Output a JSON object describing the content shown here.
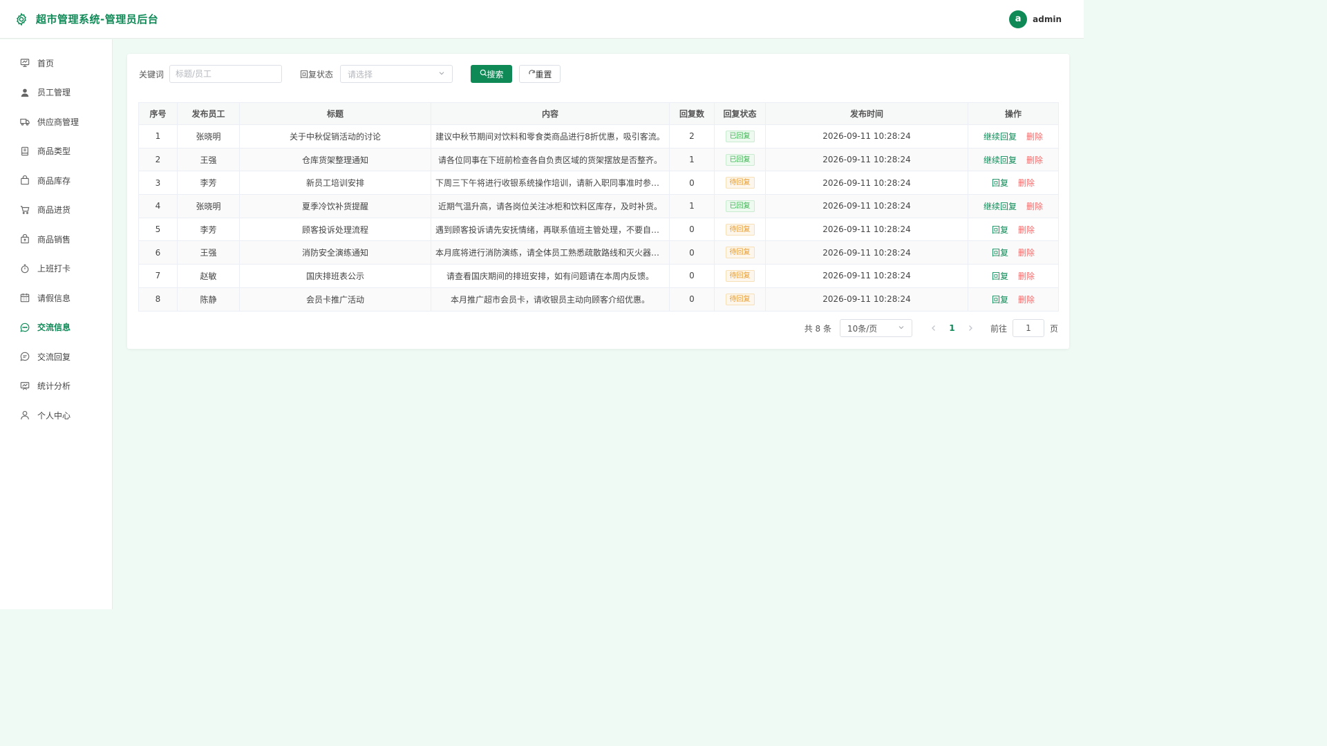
{
  "header": {
    "title": "超市管理系统-管理员后台",
    "avatar_letter": "a",
    "username": "admin",
    "logo_icon": "gear-icon"
  },
  "colors": {
    "primary": "#0f8a57",
    "danger": "#f56c6c",
    "tag_done": "#3bb34f",
    "tag_wait": "#e89b2a",
    "background": "#f0faf4"
  },
  "sidebar": {
    "items": [
      {
        "label": "首页",
        "icon": "home-icon"
      },
      {
        "label": "员工管理",
        "icon": "user-icon"
      },
      {
        "label": "供应商管理",
        "icon": "truck-icon"
      },
      {
        "label": "商品类型",
        "icon": "notebook-icon"
      },
      {
        "label": "商品库存",
        "icon": "bag-icon"
      },
      {
        "label": "商品进货",
        "icon": "cart-icon"
      },
      {
        "label": "商品销售",
        "icon": "sell-icon"
      },
      {
        "label": "上班打卡",
        "icon": "stopwatch-icon"
      },
      {
        "label": "请假信息",
        "icon": "calendar-icon"
      },
      {
        "label": "交流信息",
        "icon": "chat-dot-icon",
        "active": true
      },
      {
        "label": "交流回复",
        "icon": "chat-line-icon"
      },
      {
        "label": "统计分析",
        "icon": "data-board-icon"
      },
      {
        "label": "个人中心",
        "icon": "person-icon"
      }
    ]
  },
  "filters": {
    "keyword_label": "关键词",
    "keyword_placeholder": "标题/员工",
    "keyword_value": "",
    "status_label": "回复状态",
    "status_placeholder": "请选择",
    "search_label": "搜索",
    "reset_label": "重置"
  },
  "table": {
    "columns": [
      "序号",
      "发布员工",
      "标题",
      "内容",
      "回复数",
      "回复状态",
      "发布时间",
      "操作"
    ],
    "rows": [
      {
        "no": "1",
        "employee": "张晓明",
        "title": "关于中秋促销活动的讨论",
        "content": "建议中秋节期间对饮料和零食类商品进行8折优惠，吸引客流。",
        "replies": "2",
        "status": "已回复",
        "status_type": "done",
        "time": "2026-09-11 10:28:24",
        "reply_action": "继续回复",
        "delete_action": "删除"
      },
      {
        "no": "2",
        "employee": "王强",
        "title": "仓库货架整理通知",
        "content": "请各位同事在下班前检查各自负责区域的货架摆放是否整齐。",
        "replies": "1",
        "status": "已回复",
        "status_type": "done",
        "time": "2026-09-11 10:28:24",
        "reply_action": "继续回复",
        "delete_action": "删除"
      },
      {
        "no": "3",
        "employee": "李芳",
        "title": "新员工培训安排",
        "content": "下周三下午将进行收银系统操作培训，请新入职同事准时参加。",
        "replies": "0",
        "status": "待回复",
        "status_type": "wait",
        "time": "2026-09-11 10:28:24",
        "reply_action": "回复",
        "delete_action": "删除"
      },
      {
        "no": "4",
        "employee": "张晓明",
        "title": "夏季冷饮补货提醒",
        "content": "近期气温升高，请各岗位关注冰柜和饮料区库存，及时补货。",
        "replies": "1",
        "status": "已回复",
        "status_type": "done",
        "time": "2026-09-11 10:28:24",
        "reply_action": "继续回复",
        "delete_action": "删除"
      },
      {
        "no": "5",
        "employee": "李芳",
        "title": "顾客投诉处理流程",
        "content": "遇到顾客投诉请先安抚情绪，再联系值班主管处理，不要自行...",
        "replies": "0",
        "status": "待回复",
        "status_type": "wait",
        "time": "2026-09-11 10:28:24",
        "reply_action": "回复",
        "delete_action": "删除"
      },
      {
        "no": "6",
        "employee": "王强",
        "title": "消防安全演练通知",
        "content": "本月底将进行消防演练，请全体员工熟悉疏散路线和灭火器位...",
        "replies": "0",
        "status": "待回复",
        "status_type": "wait",
        "time": "2026-09-11 10:28:24",
        "reply_action": "回复",
        "delete_action": "删除"
      },
      {
        "no": "7",
        "employee": "赵敏",
        "title": "国庆排班表公示",
        "content": "请查看国庆期间的排班安排，如有问题请在本周内反馈。",
        "replies": "0",
        "status": "待回复",
        "status_type": "wait",
        "time": "2026-09-11 10:28:24",
        "reply_action": "回复",
        "delete_action": "删除"
      },
      {
        "no": "8",
        "employee": "陈静",
        "title": "会员卡推广活动",
        "content": "本月推广超市会员卡，请收银员主动向顾客介绍优惠。",
        "replies": "0",
        "status": "待回复",
        "status_type": "wait",
        "time": "2026-09-11 10:28:24",
        "reply_action": "回复",
        "delete_action": "删除"
      }
    ]
  },
  "pagination": {
    "total_text": "共 8 条",
    "page_size": "10条/页",
    "current_page": "1",
    "goto_label": "前往",
    "goto_value": "1",
    "page_suffix": "页"
  }
}
